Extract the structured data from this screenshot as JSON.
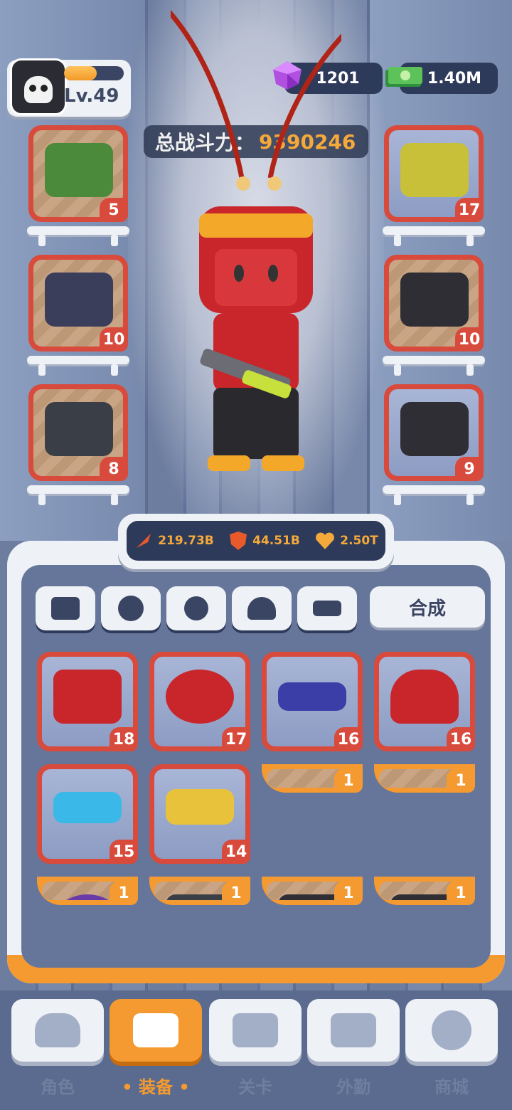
{
  "player": {
    "level": "Lv.49",
    "xp_fraction": 0.55
  },
  "currency": {
    "gems": "1201",
    "cash": "1.40M"
  },
  "power": {
    "label": "总战斗力：",
    "value": "9390246"
  },
  "left_slots": [
    {
      "icon": "rifle-icon",
      "level": "5"
    },
    {
      "icon": "grenade-icon",
      "level": "10"
    },
    {
      "icon": "ammo-drum-icon",
      "level": "8"
    }
  ],
  "right_slots": [
    {
      "icon": "blaster-icon",
      "level": "17"
    },
    {
      "icon": "skull-cap-icon",
      "level": "10"
    },
    {
      "icon": "jacket-icon",
      "level": "9"
    }
  ],
  "stats": {
    "attack": "219.73B",
    "defense": "44.51B",
    "health": "2.50T"
  },
  "category_tabs": [
    "weapon-tab-icon",
    "watch-tab-icon",
    "gear-tab-icon",
    "helmet-tab-icon",
    "base-tab-icon"
  ],
  "merge_label": "合成",
  "inventory": [
    {
      "icon": "armor-helmet-icon",
      "level": "18",
      "rarity": "red"
    },
    {
      "icon": "drum-cross-icon",
      "level": "17",
      "rarity": "red"
    },
    {
      "icon": "heavy-rifle-icon",
      "level": "16",
      "rarity": "red"
    },
    {
      "icon": "visor-helmet-icon",
      "level": "16",
      "rarity": "red"
    },
    {
      "icon": "goggles-icon",
      "level": "15",
      "rarity": "red"
    },
    {
      "icon": "golden-pistol-icon",
      "level": "14",
      "rarity": "red"
    },
    {
      "icon": "shotgun-icon",
      "level": "1",
      "rarity": "orange"
    },
    {
      "icon": "sniper-icon",
      "level": "1",
      "rarity": "orange"
    },
    {
      "icon": "crosshair-grenade-icon",
      "level": "1",
      "rarity": "orange"
    },
    {
      "icon": "ammo-drum-icon",
      "level": "1",
      "rarity": "orange"
    },
    {
      "icon": "jacket-icon",
      "level": "1",
      "rarity": "orange"
    },
    {
      "icon": "skull-cap-icon",
      "level": "1",
      "rarity": "orange"
    }
  ],
  "nav": [
    {
      "label": "角色",
      "icon": "skull-nav-icon",
      "active": false
    },
    {
      "label": "装备",
      "icon": "gun-nav-icon",
      "active": true
    },
    {
      "label": "关卡",
      "icon": "map-nav-icon",
      "active": false
    },
    {
      "label": "外勤",
      "icon": "console-nav-icon",
      "active": false
    },
    {
      "label": "商城",
      "icon": "shop-nav-icon",
      "active": false
    }
  ]
}
